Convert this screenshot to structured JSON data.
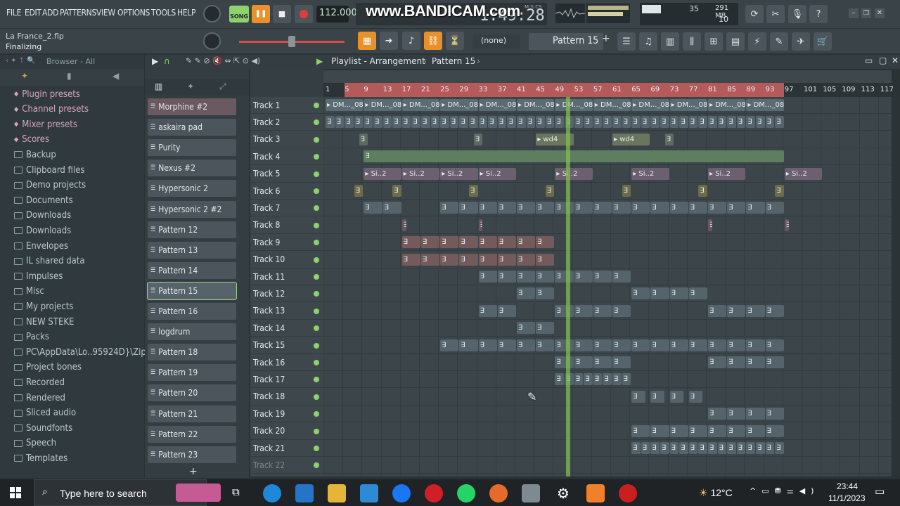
{
  "menu": {
    "items": [
      "FILE",
      "EDIT",
      "ADD",
      "PATTERNS",
      "VIEW",
      "OPTIONS",
      "TOOLS",
      "HELP"
    ]
  },
  "transport": {
    "mode": "SONG",
    "tempo": "112.000",
    "time": "1:49:28",
    "time_label": "M:S:CS"
  },
  "watermark": "www.BANDICAM.com",
  "monitor": {
    "cpu": "35",
    "memory": "291 MB",
    "polyphony": "10"
  },
  "project": {
    "file": "La France_2.flp",
    "status": "Finalizing"
  },
  "toolbar": {
    "snap": "(none)",
    "pattern": "Pattern 15"
  },
  "browser": {
    "header": "Browser - All",
    "items": [
      {
        "label": "Plugin presets",
        "style": "pink"
      },
      {
        "label": "Channel presets",
        "style": "pink"
      },
      {
        "label": "Mixer presets",
        "style": "pink"
      },
      {
        "label": "Scores",
        "style": "pink"
      },
      {
        "label": "Backup",
        "style": "folder"
      },
      {
        "label": "Clipboard files",
        "style": "folder"
      },
      {
        "label": "Demo projects",
        "style": "folder"
      },
      {
        "label": "Documents",
        "style": "folder"
      },
      {
        "label": "Downloads",
        "style": "folder"
      },
      {
        "label": "Downloads",
        "style": "folder"
      },
      {
        "label": "Envelopes",
        "style": "folder"
      },
      {
        "label": "IL shared data",
        "style": "folder"
      },
      {
        "label": "Impulses",
        "style": "folder"
      },
      {
        "label": "Misc",
        "style": "folder"
      },
      {
        "label": "My projects",
        "style": "folder"
      },
      {
        "label": "NEW STEKE",
        "style": "folder"
      },
      {
        "label": "Packs",
        "style": "folder"
      },
      {
        "label": "PC\\AppData\\Lo..95924D}\\Zip\\",
        "style": "folder"
      },
      {
        "label": "Project bones",
        "style": "folder"
      },
      {
        "label": "Recorded",
        "style": "folder"
      },
      {
        "label": "Rendered",
        "style": "folder"
      },
      {
        "label": "Sliced audio",
        "style": "folder"
      },
      {
        "label": "Soundfonts",
        "style": "folder"
      },
      {
        "label": "Speech",
        "style": "folder"
      },
      {
        "label": "Templates",
        "style": "folder"
      }
    ]
  },
  "playlist": {
    "title": "Playlist - Arrangement",
    "pattern": "Pattern 15",
    "ruler": [
      "1",
      "5",
      "9",
      "13",
      "17",
      "21",
      "25",
      "29",
      "33",
      "37",
      "41",
      "45",
      "49",
      "53",
      "57",
      "61",
      "65",
      "69",
      "73",
      "77",
      "81",
      "85",
      "89",
      "93",
      "97",
      "101",
      "105",
      "109",
      "113",
      "117"
    ]
  },
  "pattern_list": [
    "Morphine #2",
    "askaira pad",
    "Purity",
    "Nexus #2",
    "Hypersonic 2",
    "Hypersonic 2 #2",
    "Pattern 12",
    "Pattern 13",
    "Pattern 14",
    "Pattern 15",
    "Pattern 16",
    "logdrum",
    "Pattern 18",
    "Pattern 19",
    "Pattern 20",
    "Pattern 21",
    "Pattern 22",
    "Pattern 23"
  ],
  "tracks": [
    "Track 1",
    "Track 2",
    "Track 3",
    "Track 4",
    "Track 5",
    "Track 6",
    "Track 7",
    "Track 8",
    "Track 9",
    "Track 10",
    "Track 11",
    "Track 12",
    "Track 13",
    "Track 14",
    "Track 15",
    "Track 16",
    "Track 17",
    "Track 18",
    "Track 19",
    "Track 20",
    "Track 21",
    "Track 22"
  ],
  "clip_labels": {
    "dm": "DM..._08",
    "wd": "wd4",
    "si": "Si..2"
  },
  "taskbar": {
    "search": "Type here to search",
    "weather": "12°C",
    "time": "23:44",
    "date": "11/1/2023"
  },
  "colors": {
    "accent": "#e8902a",
    "song_green": "#8fd16b",
    "playhead": "#7fbf4d"
  }
}
